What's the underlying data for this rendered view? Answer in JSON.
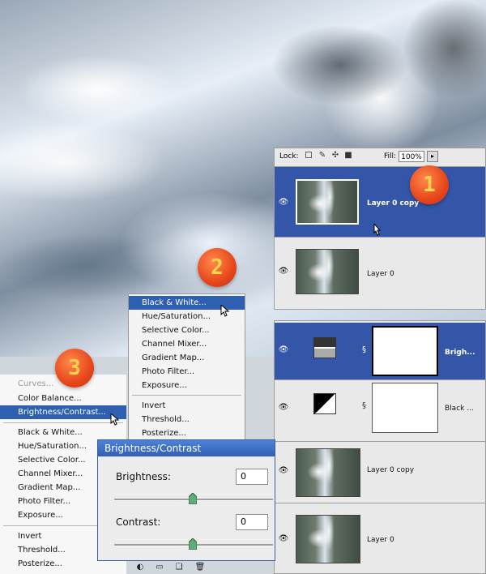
{
  "layers_panel_top": {
    "lock_label": "Lock:",
    "fill_label": "Fill:",
    "fill_value": "100%",
    "layers": [
      {
        "name": "Layer 0 copy",
        "selected": true
      },
      {
        "name": "Layer 0",
        "selected": false
      }
    ]
  },
  "layers_panel_bottom": {
    "layers": [
      {
        "name": "Brigh...",
        "selected": true,
        "kind": "brightness-contrast"
      },
      {
        "name": "Black ...",
        "selected": false,
        "kind": "black-white"
      },
      {
        "name": "Layer 0 copy",
        "selected": false,
        "kind": "image"
      },
      {
        "name": "Layer 0",
        "selected": false,
        "kind": "image"
      }
    ]
  },
  "adjust_menu_top": {
    "group1": [
      "Black & White...",
      "Hue/Saturation...",
      "Selective Color...",
      "Channel Mixer...",
      "Gradient Map...",
      "Photo Filter...",
      "Exposure..."
    ],
    "group2": [
      "Invert",
      "Threshold...",
      "Posterize..."
    ],
    "highlighted": "Black & White..."
  },
  "adjust_menu_left": {
    "group0": [
      "Curves...",
      "Color Balance...",
      "Brightness/Contrast..."
    ],
    "group1": [
      "Black & White...",
      "Hue/Saturation...",
      "Selective Color...",
      "Channel Mixer...",
      "Gradient Map...",
      "Photo Filter...",
      "Exposure..."
    ],
    "group2": [
      "Invert",
      "Threshold...",
      "Posterize..."
    ],
    "highlighted": "Brightness/Contrast..."
  },
  "dialog": {
    "title": "Brightness/Contrast",
    "brightness_label": "Brightness:",
    "brightness_value": "0",
    "contrast_label": "Contrast:",
    "contrast_value": "0"
  },
  "callouts": [
    "1",
    "2",
    "3"
  ],
  "colors": {
    "selection_blue": "#3456a8",
    "menu_highlight": "#2f5fb0",
    "callout_orange": "#e7461b",
    "callout_digit": "#ffd34d"
  },
  "icons": [
    "eye-icon",
    "lock-transparent-icon",
    "lock-brush-icon",
    "lock-move-icon",
    "lock-all-icon",
    "chain-icon",
    "adjustment-layer-icon",
    "trash-icon",
    "new-layer-icon",
    "folder-icon",
    "pointer-icon"
  ]
}
